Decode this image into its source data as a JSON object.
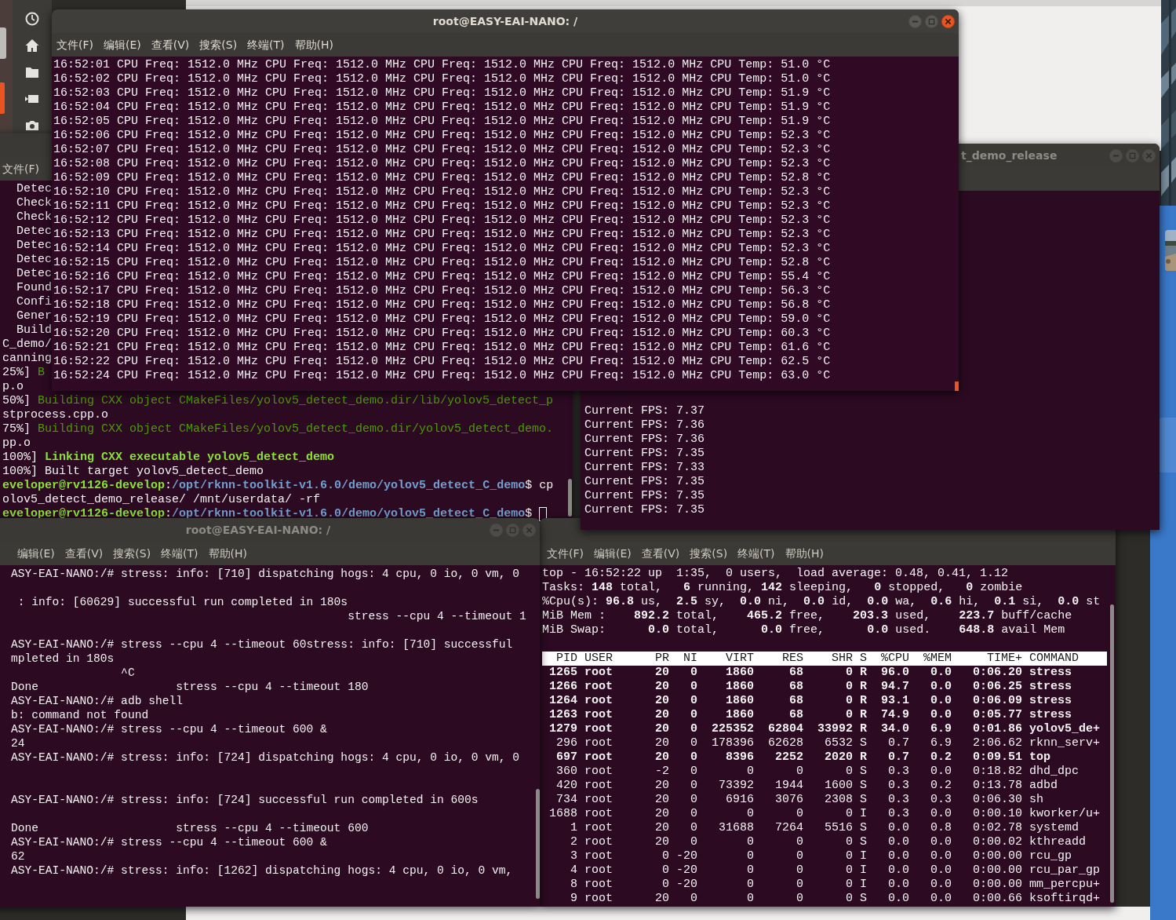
{
  "windows": [
    {
      "kind": "stats",
      "title": "root@EASY-EAI-NANO: /",
      "focused": true,
      "menu": [
        "文件(F)",
        "编辑(E)",
        "查看(V)",
        "搜索(S)",
        "终端(T)",
        "帮助(H)"
      ],
      "lines": [
        "16:52:01 CPU Freq: 1512.0 MHz CPU Freq: 1512.0 MHz CPU Freq: 1512.0 MHz CPU Freq: 1512.0 MHz CPU Temp: 51.0 °C",
        "16:52:02 CPU Freq: 1512.0 MHz CPU Freq: 1512.0 MHz CPU Freq: 1512.0 MHz CPU Freq: 1512.0 MHz CPU Temp: 51.0 °C",
        "16:52:03 CPU Freq: 1512.0 MHz CPU Freq: 1512.0 MHz CPU Freq: 1512.0 MHz CPU Freq: 1512.0 MHz CPU Temp: 51.9 °C",
        "16:52:04 CPU Freq: 1512.0 MHz CPU Freq: 1512.0 MHz CPU Freq: 1512.0 MHz CPU Freq: 1512.0 MHz CPU Temp: 51.9 °C",
        "16:52:05 CPU Freq: 1512.0 MHz CPU Freq: 1512.0 MHz CPU Freq: 1512.0 MHz CPU Freq: 1512.0 MHz CPU Temp: 51.9 °C",
        "16:52:06 CPU Freq: 1512.0 MHz CPU Freq: 1512.0 MHz CPU Freq: 1512.0 MHz CPU Freq: 1512.0 MHz CPU Temp: 52.3 °C",
        "16:52:07 CPU Freq: 1512.0 MHz CPU Freq: 1512.0 MHz CPU Freq: 1512.0 MHz CPU Freq: 1512.0 MHz CPU Temp: 52.3 °C",
        "16:52:08 CPU Freq: 1512.0 MHz CPU Freq: 1512.0 MHz CPU Freq: 1512.0 MHz CPU Freq: 1512.0 MHz CPU Temp: 52.3 °C",
        "16:52:09 CPU Freq: 1512.0 MHz CPU Freq: 1512.0 MHz CPU Freq: 1512.0 MHz CPU Freq: 1512.0 MHz CPU Temp: 52.8 °C",
        "16:52:10 CPU Freq: 1512.0 MHz CPU Freq: 1512.0 MHz CPU Freq: 1512.0 MHz CPU Freq: 1512.0 MHz CPU Temp: 52.3 °C",
        "16:52:11 CPU Freq: 1512.0 MHz CPU Freq: 1512.0 MHz CPU Freq: 1512.0 MHz CPU Freq: 1512.0 MHz CPU Temp: 52.3 °C",
        "16:52:12 CPU Freq: 1512.0 MHz CPU Freq: 1512.0 MHz CPU Freq: 1512.0 MHz CPU Freq: 1512.0 MHz CPU Temp: 52.3 °C",
        "16:52:13 CPU Freq: 1512.0 MHz CPU Freq: 1512.0 MHz CPU Freq: 1512.0 MHz CPU Freq: 1512.0 MHz CPU Temp: 52.3 °C",
        "16:52:14 CPU Freq: 1512.0 MHz CPU Freq: 1512.0 MHz CPU Freq: 1512.0 MHz CPU Freq: 1512.0 MHz CPU Temp: 52.3 °C",
        "16:52:15 CPU Freq: 1512.0 MHz CPU Freq: 1512.0 MHz CPU Freq: 1512.0 MHz CPU Freq: 1512.0 MHz CPU Temp: 52.8 °C",
        "16:52:16 CPU Freq: 1512.0 MHz CPU Freq: 1512.0 MHz CPU Freq: 1512.0 MHz CPU Freq: 1512.0 MHz CPU Temp: 55.4 °C",
        "16:52:17 CPU Freq: 1512.0 MHz CPU Freq: 1512.0 MHz CPU Freq: 1512.0 MHz CPU Freq: 1512.0 MHz CPU Temp: 56.3 °C",
        "16:52:18 CPU Freq: 1512.0 MHz CPU Freq: 1512.0 MHz CPU Freq: 1512.0 MHz CPU Freq: 1512.0 MHz CPU Temp: 56.8 °C",
        "16:52:19 CPU Freq: 1512.0 MHz CPU Freq: 1512.0 MHz CPU Freq: 1512.0 MHz CPU Freq: 1512.0 MHz CPU Temp: 59.0 °C",
        "16:52:20 CPU Freq: 1512.0 MHz CPU Freq: 1512.0 MHz CPU Freq: 1512.0 MHz CPU Freq: 1512.0 MHz CPU Temp: 60.3 °C",
        "16:52:21 CPU Freq: 1512.0 MHz CPU Freq: 1512.0 MHz CPU Freq: 1512.0 MHz CPU Freq: 1512.0 MHz CPU Temp: 61.6 °C",
        "16:52:22 CPU Freq: 1512.0 MHz CPU Freq: 1512.0 MHz CPU Freq: 1512.0 MHz CPU Freq: 1512.0 MHz CPU Temp: 62.5 °C",
        "16:52:24 CPU Freq: 1512.0 MHz CPU Freq: 1512.0 MHz CPU Freq: 1512.0 MHz CPU Freq: 1512.0 MHz CPU Temp: 63.0 °C"
      ]
    },
    {
      "kind": "build",
      "focused": false,
      "menu": [
        "文件(F)"
      ],
      "lines": [
        "  Detec",
        "  Check",
        "  Check",
        "  Detec",
        "  Detec",
        "  Detec",
        "  Detec",
        "  Found",
        "  Confi",
        "  Gener",
        "  Build",
        "C_demo/",
        "canning",
        {
          "kind": "progress",
          "prefix": "25%] ",
          "text": "B"
        },
        "p.o",
        {
          "kind": "progress",
          "prefix": "50%] ",
          "text": "Building CXX object CMakeFiles/yolov5_detect_demo.dir/lib/yolov5_detect_p"
        },
        "stprocess.cpp.o",
        {
          "kind": "progress",
          "prefix": "75%] ",
          "text": "Building CXX object CMakeFiles/yolov5_detect_demo.dir/yolov5_detect_demo."
        },
        "pp.o",
        {
          "kind": "link",
          "prefix": "100%] ",
          "text": "Linking CXX executable yolov5_detect_demo"
        },
        "100%] Built target yolov5_detect_demo",
        {
          "kind": "prompt",
          "user": "eveloper@rv1126-develop",
          "sep": ":",
          "path": "/opt/rknn-toolkit-v1.6.0/demo/yolov5_detect_C_demo",
          "text": "$ cp"
        },
        "olov5_detect_demo_release/ /mnt/userdata/ -rf",
        {
          "kind": "prompt",
          "user": "eveloper@rv1126-develop",
          "sep": ":",
          "path": "/opt/rknn-toolkit-v1.6.0/demo/yolov5_detect_C_demo",
          "text": "$",
          "cursor": true
        }
      ]
    },
    {
      "kind": "fps",
      "title": "t_demo_release",
      "focused": false,
      "lines": [
        "Current FPS: 7.37",
        "Current FPS: 7.36",
        "Current FPS: 7.36",
        "Current FPS: 7.35",
        "Current FPS: 7.33",
        "Current FPS: 7.35",
        "Current FPS: 7.35",
        "Current FPS: 7.35"
      ]
    },
    {
      "kind": "stress",
      "title": "root@EASY-EAI-NANO: /",
      "focused": false,
      "menu": [
        "编辑(E)",
        "查看(V)",
        "搜索(S)",
        "终端(T)",
        "帮助(H)"
      ],
      "lines": [
        "ASY-EAI-NANO:/# stress: info: [710] dispatching hogs: 4 cpu, 0 io, 0 vm, 0",
        {
          "kind": "blank"
        },
        " : info: [60629] successful run completed in 180s",
        "                                                 stress --cpu 4 --timeout 1",
        {
          "kind": "blank"
        },
        "ASY-EAI-NANO:/# stress --cpu 4 --timeout 60stress: info: [710] successful",
        "mpleted in 180s",
        "                ^C",
        "Done                    stress --cpu 4 --timeout 180",
        "ASY-EAI-NANO:/# adb shell",
        "b: command not found",
        "ASY-EAI-NANO:/# stress --cpu 4 --timeout 600 &",
        "24",
        "ASY-EAI-NANO:/# stress: info: [724] dispatching hogs: 4 cpu, 0 io, 0 vm, 0",
        {
          "kind": "blank"
        },
        {
          "kind": "blank"
        },
        "ASY-EAI-NANO:/# stress: info: [724] successful run completed in 600s",
        {
          "kind": "blank"
        },
        "Done                    stress --cpu 4 --timeout 600",
        "ASY-EAI-NANO:/# stress --cpu 4 --timeout 600 &",
        "62",
        "ASY-EAI-NANO:/# stress: info: [1262] dispatching hogs: 4 cpu, 0 io, 0 vm,"
      ]
    },
    {
      "kind": "monitor",
      "focused": false,
      "menu": [
        "文件(F)",
        "编辑(E)",
        "查看(V)",
        "搜索(S)",
        "终端(T)",
        "帮助(H)"
      ],
      "summary": [
        "top - 16:52:22 up  1:35,  0 users,  load average: 0.48, 0.41, 1.12",
        "Tasks: **148** total,   **6** running, **142** sleeping,   **0** stopped,   **0** zombie",
        "%Cpu(s): **96.8** us,  **2.5** sy,  **0.0** ni,  **0.0** id,  **0.0** wa,  **0.6** hi,  **0.1** si,  **0.0** st",
        "MiB Mem :    **892.2** total,    **465.2** free,    **203.3** used,    **223.7** buff/cache",
        "MiB Swap:      **0.0** total,      **0.0** free,      **0.0** used.    **648.8** avail Mem"
      ],
      "columns": [
        "PID",
        "USER",
        "PR",
        "NI",
        "VIRT",
        "RES",
        "SHR",
        "S",
        "%CPU",
        "%MEM",
        "TIME+",
        "COMMAND"
      ],
      "rows": [
        {
          "bold": true,
          "cells": [
            "1265",
            "root",
            "20",
            "0",
            "1860",
            "68",
            "0",
            "R",
            "96.0",
            "0.0",
            "0:06.20",
            "stress"
          ]
        },
        {
          "bold": true,
          "cells": [
            "1266",
            "root",
            "20",
            "0",
            "1860",
            "68",
            "0",
            "R",
            "94.7",
            "0.0",
            "0:06.25",
            "stress"
          ]
        },
        {
          "bold": true,
          "cells": [
            "1264",
            "root",
            "20",
            "0",
            "1860",
            "68",
            "0",
            "R",
            "93.1",
            "0.0",
            "0:06.09",
            "stress"
          ]
        },
        {
          "bold": true,
          "cells": [
            "1263",
            "root",
            "20",
            "0",
            "1860",
            "68",
            "0",
            "R",
            "74.9",
            "0.0",
            "0:05.77",
            "stress"
          ]
        },
        {
          "bold": true,
          "cells": [
            "1279",
            "root",
            "20",
            "0",
            "225352",
            "62804",
            "33992",
            "R",
            "34.0",
            "6.9",
            "0:01.86",
            "yolov5_de+"
          ]
        },
        {
          "bold": false,
          "cells": [
            "296",
            "root",
            "20",
            "0",
            "178396",
            "62628",
            "6532",
            "S",
            "0.7",
            "6.9",
            "2:06.62",
            "rknn_serv+"
          ]
        },
        {
          "bold": true,
          "cells": [
            "697",
            "root",
            "20",
            "0",
            "8396",
            "2252",
            "2020",
            "R",
            "0.7",
            "0.2",
            "0:09.51",
            "top"
          ]
        },
        {
          "bold": false,
          "cells": [
            "360",
            "root",
            "-2",
            "0",
            "0",
            "0",
            "0",
            "S",
            "0.3",
            "0.0",
            "0:18.82",
            "dhd_dpc"
          ]
        },
        {
          "bold": false,
          "cells": [
            "420",
            "root",
            "20",
            "0",
            "73392",
            "1944",
            "1600",
            "S",
            "0.3",
            "0.2",
            "0:13.78",
            "adbd"
          ]
        },
        {
          "bold": false,
          "cells": [
            "734",
            "root",
            "20",
            "0",
            "6916",
            "3076",
            "2308",
            "S",
            "0.3",
            "0.3",
            "0:06.30",
            "sh"
          ]
        },
        {
          "bold": false,
          "cells": [
            "1688",
            "root",
            "20",
            "0",
            "0",
            "0",
            "0",
            "I",
            "0.3",
            "0.0",
            "0:00.10",
            "kworker/u+"
          ]
        },
        {
          "bold": false,
          "cells": [
            "1",
            "root",
            "20",
            "0",
            "31688",
            "7264",
            "5516",
            "S",
            "0.0",
            "0.8",
            "0:02.78",
            "systemd"
          ]
        },
        {
          "bold": false,
          "cells": [
            "2",
            "root",
            "20",
            "0",
            "0",
            "0",
            "0",
            "S",
            "0.0",
            "0.0",
            "0:00.02",
            "kthreadd"
          ]
        },
        {
          "bold": false,
          "cells": [
            "3",
            "root",
            "0",
            "-20",
            "0",
            "0",
            "0",
            "I",
            "0.0",
            "0.0",
            "0:00.00",
            "rcu_gp"
          ]
        },
        {
          "bold": false,
          "cells": [
            "4",
            "root",
            "0",
            "-20",
            "0",
            "0",
            "0",
            "I",
            "0.0",
            "0.0",
            "0:00.00",
            "rcu_par_gp"
          ]
        },
        {
          "bold": false,
          "cells": [
            "8",
            "root",
            "0",
            "-20",
            "0",
            "0",
            "0",
            "I",
            "0.0",
            "0.0",
            "0:00.00",
            "mm_percpu+"
          ]
        },
        {
          "bold": false,
          "cells": [
            "9",
            "root",
            "20",
            "0",
            "0",
            "0",
            "0",
            "S",
            "0.0",
            "0.0",
            "0:00.66",
            "ksoftirqd+"
          ]
        }
      ]
    }
  ]
}
